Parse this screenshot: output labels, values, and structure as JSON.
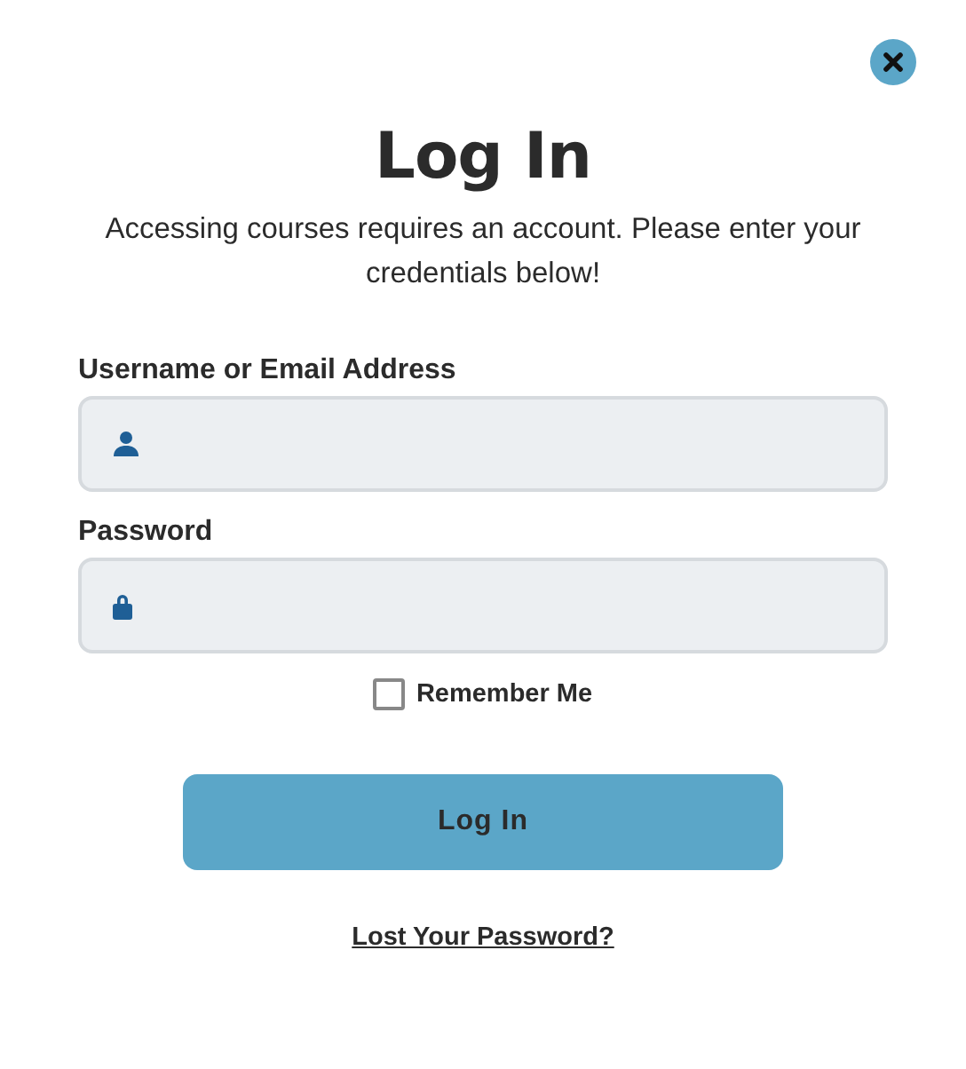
{
  "dialog": {
    "title": "Log In",
    "intro": "Accessing courses requires an account. Please enter your credentials below!",
    "fields": [
      {
        "label": "Username or Email Address",
        "kind": "user"
      },
      {
        "label": "Password",
        "kind": "lock"
      }
    ],
    "remember": {
      "label": "Remember Me",
      "checked": false
    },
    "submit": "Log In",
    "lost_password": "Lost Your Password?"
  }
}
